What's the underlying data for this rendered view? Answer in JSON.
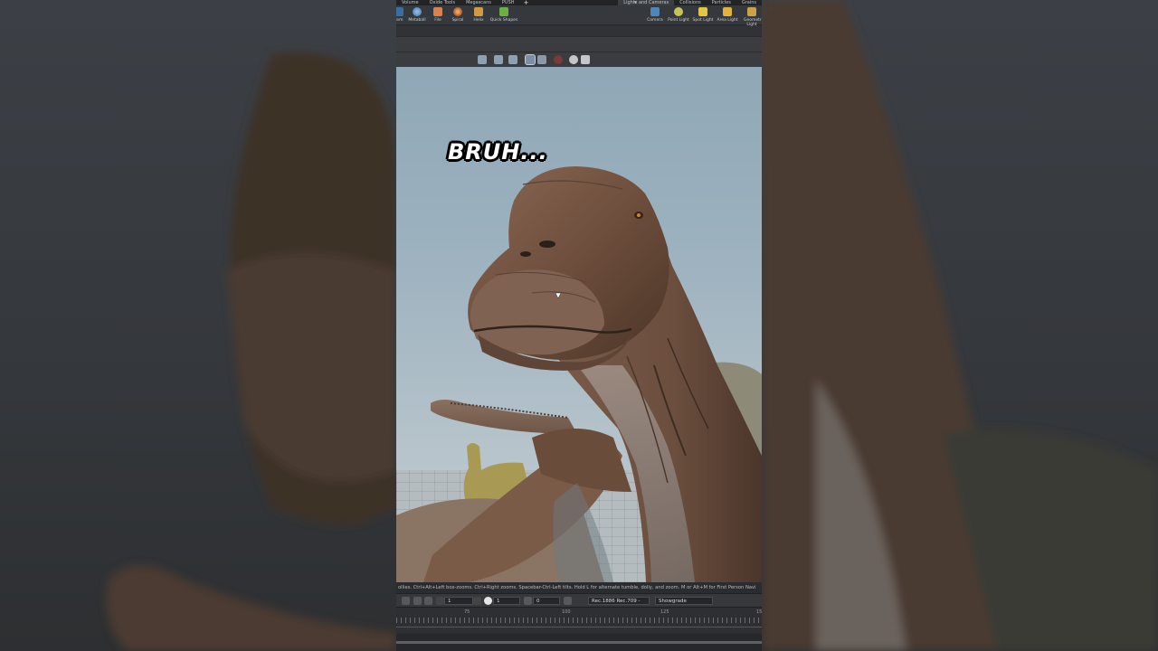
{
  "shelf": {
    "tabs": [
      "Volume",
      "Oxide Tools",
      "Megascans",
      "PUSH",
      "+"
    ],
    "right_tabs": [
      "Lights and Cameras",
      "Collisions",
      "Particles",
      "Grains"
    ],
    "dropdown_glyph": "▾"
  },
  "tools": [
    {
      "label": "tem",
      "icon": "partial-icon"
    },
    {
      "label": "Metaball",
      "icon": "metaball-icon"
    },
    {
      "label": "File",
      "icon": "file-icon"
    },
    {
      "label": "Spiral",
      "icon": "spiral-icon"
    },
    {
      "label": "Helix",
      "icon": "helix-icon"
    },
    {
      "label": "Quick Shapes",
      "icon": "quick-shapes-icon"
    }
  ],
  "light_tools": [
    {
      "label": "Camera",
      "icon": "camera-icon"
    },
    {
      "label": "Point Light",
      "icon": "point-light-icon"
    },
    {
      "label": "Spot Light",
      "icon": "spot-light-icon"
    },
    {
      "label": "Area Light",
      "icon": "area-light-icon"
    },
    {
      "label": "Geometry Light",
      "icon": "geometry-light-icon"
    }
  ],
  "caption": "BRUH...",
  "status_text": "ollies. Ctrl+Alt+Left box-zooms. Ctrl+Right zooms. Spacebar-Ctrl-Left tilts. Hold L for alternate tumble, dolly, and zoom. M or Alt+M for First Person Navi",
  "playbar": {
    "frame_step": "1",
    "exposure": "1",
    "gamma": "0",
    "colorspace": "Rec.1886 Rec.709 -",
    "view": "Showgrade"
  },
  "timeline": {
    "ticks": [
      "75",
      "100",
      "125",
      "15"
    ]
  },
  "colors": {
    "sky_top": "#8fa7b6",
    "dino_skin": "#7a5a47",
    "caption_fill": "#ffffff",
    "caption_outline": "#000000"
  }
}
